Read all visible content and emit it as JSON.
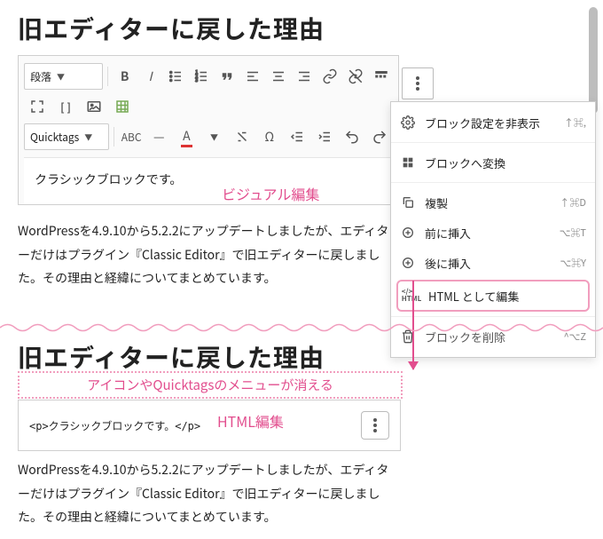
{
  "top": {
    "heading": "旧エディターに戻した理由",
    "toolbar": {
      "format": "段落",
      "quicktags": "Quicktags"
    },
    "content": "クラシックブロックです。",
    "body": "WordPressを4.9.10から5.2.2にアップデートしましたが、エディターだけはプラグイン『Classic Editor』で旧エディターに戻しました。その理由と経緯についてまとめています。"
  },
  "menu": {
    "items": [
      {
        "label": "ブロック設定を非表示",
        "shortcut": "↑⌘,"
      },
      {
        "label": "ブロックへ変換"
      },
      {
        "label": "複製",
        "shortcut": "↑⌘D"
      },
      {
        "label": "前に挿入",
        "shortcut": "⌥⌘T"
      },
      {
        "label": "後に挿入",
        "shortcut": "⌥⌘Y"
      },
      {
        "label": "HTML として編集"
      },
      {
        "label": "ブロックを削除",
        "shortcut": "^⌥Z"
      }
    ]
  },
  "annotations": {
    "visual": "ビジュアル編集",
    "menus_gone": "アイコンやQuicktagsのメニューが消える",
    "html": "HTML編集"
  },
  "bottom": {
    "heading": "旧エディターに戻した理由",
    "html_content": "<p>クラシックブロックです。</p>",
    "body": "WordPressを4.9.10から5.2.2にアップデートしましたが、エディターだけはプラグイン『Classic Editor』で旧エディターに戻しました。その理由と経緯についてまとめています。"
  }
}
